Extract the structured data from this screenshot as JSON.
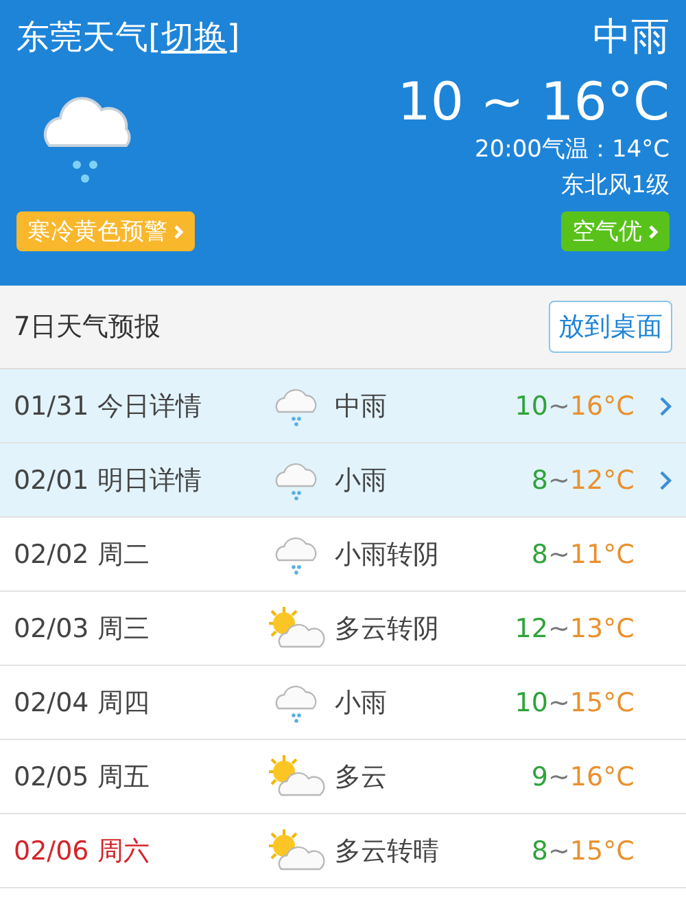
{
  "header": {
    "city": "东莞天气",
    "switch_open": "[",
    "switch_link": "切换",
    "switch_close": "]",
    "condition": "中雨",
    "temperature": "10 ~ 16°C",
    "current": "20:00气温：14°C",
    "wind": "东北风1级",
    "alert": "寒冷黄色预警",
    "air": "空气优"
  },
  "forecast": {
    "title": "7日天气预报",
    "button": "放到桌面",
    "rows": [
      {
        "date": "01/31",
        "day": "今日详情",
        "kind": "rain",
        "weather": "中雨",
        "low": "10",
        "tilde": "~",
        "high": "16°C",
        "linked": true,
        "weekend": false
      },
      {
        "date": "02/01",
        "day": "明日详情",
        "kind": "rain",
        "weather": "小雨",
        "low": "8",
        "tilde": "~",
        "high": "12°C",
        "linked": true,
        "weekend": false
      },
      {
        "date": "02/02",
        "day": "周二",
        "kind": "rain",
        "weather": "小雨转阴",
        "low": "8",
        "tilde": "~",
        "high": "11°C",
        "linked": false,
        "weekend": false
      },
      {
        "date": "02/03",
        "day": "周三",
        "kind": "partly_cloudy",
        "weather": "多云转阴",
        "low": "12",
        "tilde": "~",
        "high": "13°C",
        "linked": false,
        "weekend": false
      },
      {
        "date": "02/04",
        "day": "周四",
        "kind": "rain",
        "weather": "小雨",
        "low": "10",
        "tilde": "~",
        "high": "15°C",
        "linked": false,
        "weekend": false
      },
      {
        "date": "02/05",
        "day": "周五",
        "kind": "partly_cloudy",
        "weather": "多云",
        "low": "9",
        "tilde": "~",
        "high": "16°C",
        "linked": false,
        "weekend": false
      },
      {
        "date": "02/06",
        "day": "周六",
        "kind": "partly_cloudy",
        "weather": "多云转晴",
        "low": "8",
        "tilde": "~",
        "high": "15°C",
        "linked": false,
        "weekend": true
      }
    ]
  }
}
